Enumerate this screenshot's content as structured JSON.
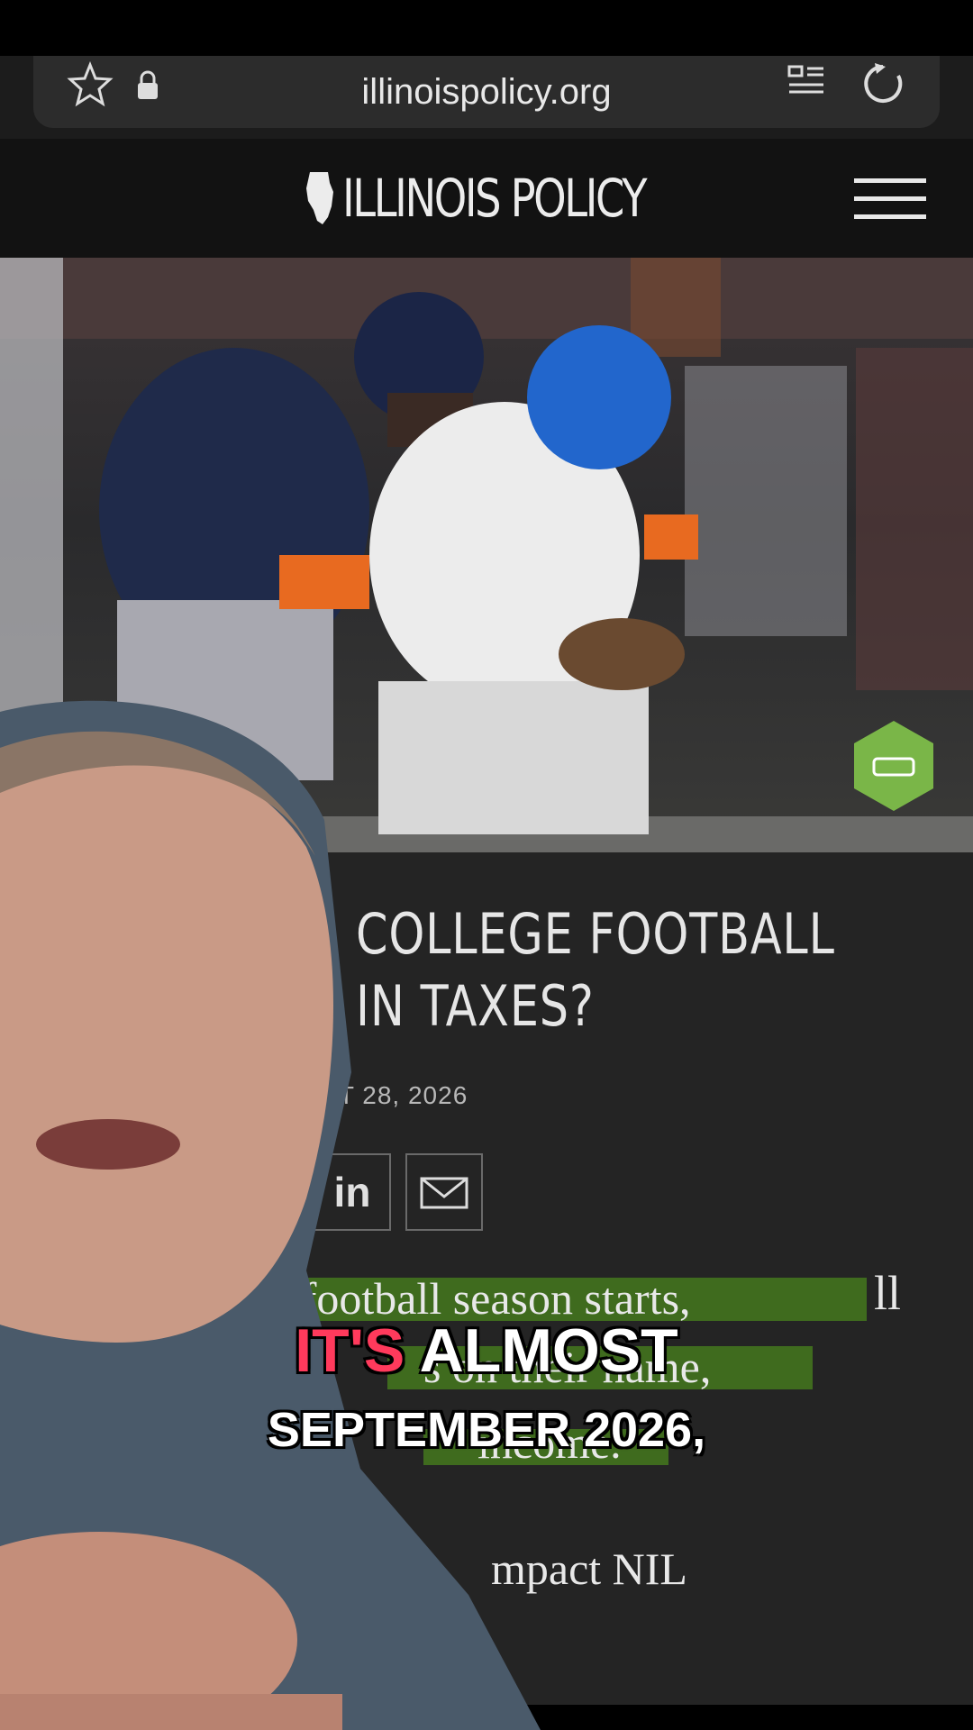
{
  "browser": {
    "url": "illinoispolicy.org"
  },
  "site": {
    "logo_text": "ILLINOIS POLICY"
  },
  "article": {
    "headline_line1": "COLLEGE FOOTBALL",
    "headline_line2": "IN TAXES?",
    "date": "UST 28, 2026",
    "share": {
      "linkedin": "in"
    },
    "body_line1_partial": "e football season starts,",
    "body_line1_end": "ll",
    "body_line2_partial": "s on their name,",
    "body_line3_partial": "income.",
    "body_line4_partial": "mpact NIL"
  },
  "caption": {
    "line1_highlight": "IT'S",
    "line1_rest": "ALMOST",
    "line2": "SEPTEMBER 2026,",
    "highlight_color": "#ff3a5c"
  },
  "colors": {
    "highlight_green": "#3f6b1e",
    "badge_green": "#7ab648"
  }
}
